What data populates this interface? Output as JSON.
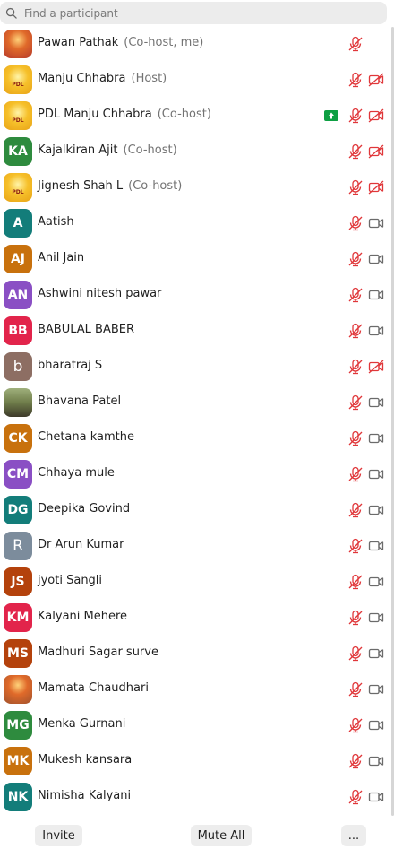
{
  "search": {
    "placeholder": "Find a participant"
  },
  "colors": {
    "mic_muted": "#e0373a",
    "video_on": "#6b6b6b",
    "share": "#0e9f43",
    "role": "#737373"
  },
  "participants": [
    {
      "name": "Pawan Pathak",
      "role": "(Co-host, me)",
      "avatar": {
        "type": "image",
        "icon": "deity-photo",
        "bg": "#b5392c"
      },
      "mic": "muted",
      "video": "none",
      "sharing": false
    },
    {
      "name": "Manju Chhabra",
      "role": "(Host)",
      "avatar": {
        "type": "image",
        "icon": "pdl-logo",
        "bg": "#e8a317",
        "text": "PDL"
      },
      "mic": "muted",
      "video": "off",
      "sharing": false
    },
    {
      "name": "PDL Manju Chhabra",
      "role": "(Co-host)",
      "avatar": {
        "type": "image",
        "icon": "pdl-logo",
        "bg": "#e8a317",
        "text": "PDL"
      },
      "mic": "muted",
      "video": "off",
      "sharing": true
    },
    {
      "name": "Kajalkiran Ajit",
      "role": "(Co-host)",
      "avatar": {
        "type": "initials",
        "initials": "KA",
        "bg": "#2e8b3e"
      },
      "mic": "muted",
      "video": "off",
      "sharing": false
    },
    {
      "name": "Jignesh Shah L",
      "role": "(Co-host)",
      "avatar": {
        "type": "image",
        "icon": "pdl-logo",
        "bg": "#e8a317",
        "text": "PDL"
      },
      "mic": "muted",
      "video": "off",
      "sharing": false
    },
    {
      "name": "Aatish",
      "role": "",
      "avatar": {
        "type": "initials",
        "initials": "A",
        "bg": "#137d7a"
      },
      "mic": "muted",
      "video": "on",
      "sharing": false
    },
    {
      "name": "Anil Jain",
      "role": "",
      "avatar": {
        "type": "initials",
        "initials": "AJ",
        "bg": "#c8710d"
      },
      "mic": "muted",
      "video": "on",
      "sharing": false
    },
    {
      "name": "Ashwini nitesh pawar",
      "role": "",
      "avatar": {
        "type": "initials",
        "initials": "AN",
        "bg": "#8a4fc4"
      },
      "mic": "muted",
      "video": "on",
      "sharing": false
    },
    {
      "name": "BABULAL BABER",
      "role": "",
      "avatar": {
        "type": "initials",
        "initials": "BB",
        "bg": "#e2244b"
      },
      "mic": "muted",
      "video": "on",
      "sharing": false
    },
    {
      "name": "bharatraj S",
      "role": "",
      "avatar": {
        "type": "initials",
        "initials": "b",
        "bg": "#8d6e63"
      },
      "mic": "muted",
      "video": "off",
      "sharing": false
    },
    {
      "name": "Bhavana Patel",
      "role": "",
      "avatar": {
        "type": "image",
        "icon": "profile-photo",
        "bg": "#7a8a5a"
      },
      "mic": "muted",
      "video": "on",
      "sharing": false
    },
    {
      "name": "Chetana kamthe",
      "role": "",
      "avatar": {
        "type": "initials",
        "initials": "CK",
        "bg": "#c8710d"
      },
      "mic": "muted",
      "video": "on",
      "sharing": false
    },
    {
      "name": "Chhaya mule",
      "role": "",
      "avatar": {
        "type": "initials",
        "initials": "CM",
        "bg": "#8a4fc4"
      },
      "mic": "muted",
      "video": "on",
      "sharing": false
    },
    {
      "name": "Deepika Govind",
      "role": "",
      "avatar": {
        "type": "initials",
        "initials": "DG",
        "bg": "#137d7a"
      },
      "mic": "muted",
      "video": "on",
      "sharing": false
    },
    {
      "name": "Dr Arun Kumar",
      "role": "",
      "avatar": {
        "type": "initials",
        "initials": "R",
        "bg": "#7c8c9c"
      },
      "mic": "muted",
      "video": "on",
      "sharing": false
    },
    {
      "name": "jyoti Sangli",
      "role": "",
      "avatar": {
        "type": "initials",
        "initials": "JS",
        "bg": "#b4420c"
      },
      "mic": "muted",
      "video": "on",
      "sharing": false
    },
    {
      "name": "Kalyani Mehere",
      "role": "",
      "avatar": {
        "type": "initials",
        "initials": "KM",
        "bg": "#e2244b"
      },
      "mic": "muted",
      "video": "on",
      "sharing": false
    },
    {
      "name": "Madhuri Sagar surve",
      "role": "",
      "avatar": {
        "type": "initials",
        "initials": "MS",
        "bg": "#b4420c"
      },
      "mic": "muted",
      "video": "on",
      "sharing": false
    },
    {
      "name": "Mamata Chaudhari",
      "role": "",
      "avatar": {
        "type": "image",
        "icon": "deity-photo",
        "bg": "#a0522d"
      },
      "mic": "muted",
      "video": "on",
      "sharing": false
    },
    {
      "name": "Menka Gurnani",
      "role": "",
      "avatar": {
        "type": "initials",
        "initials": "MG",
        "bg": "#2e8b3e"
      },
      "mic": "muted",
      "video": "on",
      "sharing": false
    },
    {
      "name": "Mukesh kansara",
      "role": "",
      "avatar": {
        "type": "initials",
        "initials": "MK",
        "bg": "#c8710d"
      },
      "mic": "muted",
      "video": "on",
      "sharing": false
    },
    {
      "name": "Nimisha Kalyani",
      "role": "",
      "avatar": {
        "type": "initials",
        "initials": "NK",
        "bg": "#137d7a"
      },
      "mic": "muted",
      "video": "on",
      "sharing": false
    }
  ],
  "footer": {
    "invite_label": "Invite",
    "mute_all_label": "Mute All",
    "more_label": "..."
  }
}
